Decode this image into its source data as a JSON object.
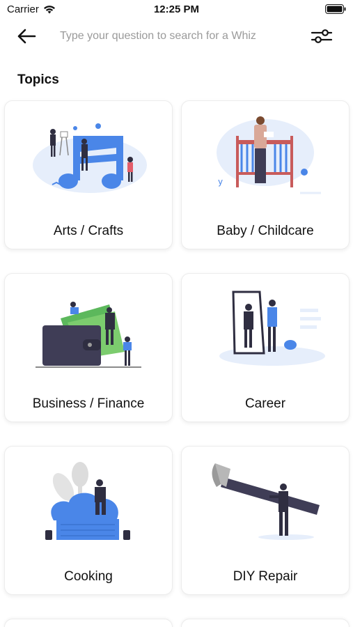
{
  "status_bar": {
    "carrier": "Carrier",
    "time": "12:25 PM",
    "icons": [
      "wifi-icon",
      "battery-icon"
    ]
  },
  "search": {
    "placeholder": "Type your question to search for a Whiz",
    "value": "",
    "back_icon": "arrow-left-icon",
    "filter_icon": "sliders-icon"
  },
  "section": {
    "title": "Topics"
  },
  "topics": [
    {
      "label": "Arts / Crafts",
      "illustration": "music-notes-illustration"
    },
    {
      "label": "Baby / Childcare",
      "illustration": "crib-illustration"
    },
    {
      "label": "Business / Finance",
      "illustration": "wallet-illustration"
    },
    {
      "label": "Career",
      "illustration": "mirror-illustration"
    },
    {
      "label": "Cooking",
      "illustration": "chef-hat-illustration"
    },
    {
      "label": "DIY Repair",
      "illustration": "hammer-illustration"
    }
  ],
  "colors": {
    "accent_blue": "#4a86e8",
    "dark_figure": "#2f2e41",
    "soft_blue": "#e6eefb",
    "green_money": "#5cb85c",
    "card_border": "#ececec"
  }
}
